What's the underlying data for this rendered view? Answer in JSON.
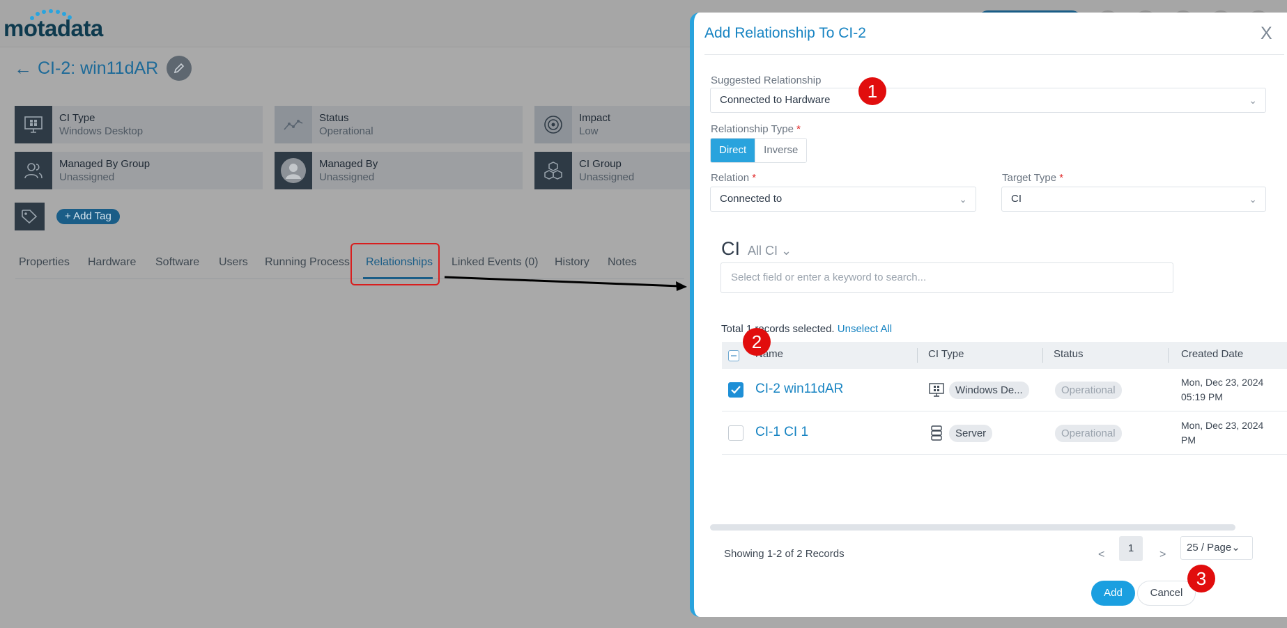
{
  "app": {
    "logo": "motadata"
  },
  "page": {
    "back_arrow": "←",
    "title": "CI-2: win11dAR",
    "cards": [
      {
        "label": "CI Type",
        "value": "Windows Desktop"
      },
      {
        "label": "Status",
        "value": "Operational"
      },
      {
        "label": "Impact",
        "value": "Low"
      },
      {
        "label": "Managed By Group",
        "value": "Unassigned"
      },
      {
        "label": "Managed By",
        "value": "Unassigned"
      },
      {
        "label": "CI Group",
        "value": "Unassigned"
      }
    ],
    "add_tag": "+ Add Tag",
    "tabs": [
      "Properties",
      "Hardware",
      "Software",
      "Users",
      "Running Process",
      "Relationships",
      "Linked Events (0)",
      "History",
      "Notes"
    ]
  },
  "modal": {
    "title": "Add Relationship To CI-2",
    "close": "X",
    "suggested_label": "Suggested Relationship",
    "suggested_value": "Connected to Hardware",
    "rel_type_label": "Relationship Type",
    "rel_type_options": [
      "Direct",
      "Inverse"
    ],
    "relation_label": "Relation",
    "relation_value": "Connected to",
    "target_label": "Target Type",
    "target_value": "CI",
    "required_mark": "*",
    "ci_heading": "CI",
    "ci_filter": "All CI",
    "search_placeholder": "Select field or enter a keyword to search...",
    "selection_text": "Total 1 records selected.",
    "unselect_all": "Unselect All",
    "columns": [
      "Name",
      "CI Type",
      "Status",
      "Created Date"
    ],
    "rows": [
      {
        "name": "CI-2 win11dAR",
        "ci_type": "Windows De...",
        "status": "Operational",
        "date_line1": "Mon, Dec 23, 2024",
        "date_line2": "05:19 PM",
        "checked": true
      },
      {
        "name": "CI-1 CI 1",
        "ci_type": "Server",
        "status": "Operational",
        "date_line1": "Mon, Dec 23, 2024",
        "date_line2": "PM",
        "checked": false
      }
    ],
    "showing": "Showing 1-2 of 2 Records",
    "prev": "<",
    "page": "1",
    "next": ">",
    "per_page": "25 / Page",
    "add": "Add",
    "cancel": "Cancel"
  },
  "annotations": [
    "1",
    "2",
    "3"
  ],
  "colors": {
    "accent": "#29a3dd",
    "link": "#1683c2",
    "annotation": "#e10d0d"
  }
}
